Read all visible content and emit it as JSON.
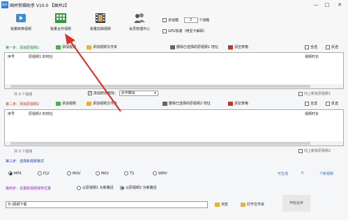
{
  "window": {
    "title": "国并剪辑助手 V10.0 【国并2】",
    "icon_label": "国并",
    "controls": [
      "—",
      "□",
      "✕"
    ]
  },
  "toolbar": {
    "buttons": [
      {
        "label": "批量转换视频",
        "icon": "convert-icon"
      },
      {
        "label": "批量合并视频",
        "icon": "merge-icon"
      },
      {
        "label": "批量剪辑视频",
        "icon": "clip-icon"
      },
      {
        "label": "会员管理中心",
        "icon": "member-icon"
      }
    ],
    "multithread_label": "多线程",
    "thread_count": "2",
    "thread_unit": "个线程",
    "gpu_label": "GPU加速（用显卡解码）"
  },
  "step1": {
    "label": "第一步：添加原视频1",
    "add_video": "添加视频",
    "add_folder": "添加视频文件夹",
    "delete_selected": "删除已选择的原视频1 地址",
    "clear_table": "清空表格",
    "select_all": "全选",
    "invert_select": "反选",
    "columns": {
      "index": "序号",
      "address": "原视频1 的地址",
      "duration": "视频时长"
    },
    "count_text": "共 0 个视频",
    "add_watermark_label": "添加转场特效：",
    "watermark_value": "水平推出",
    "up_all_label": "向上新有原视频1"
  },
  "step2": {
    "label": "第二步：添加原视频2",
    "add_video": "添加视频",
    "add_folder": "添加视频文件夹",
    "delete_selected": "删除已选择的原视频2 地址",
    "clear_table": "清空表格",
    "select_all": "全选",
    "invert_select": "反选",
    "columns": {
      "index": "序号",
      "address": "原视频2 的地址",
      "duration": "视频时长"
    },
    "count_text": "共 0 个视频",
    "up_all_label": "向上新有原视频2"
  },
  "step3": {
    "label": "第三步：选择新视频格式",
    "formats": [
      "MP4",
      "FLV",
      "MOV",
      "MKV",
      "TS",
      "WMV"
    ],
    "selected": "MP4",
    "generate_label": "可生成",
    "generate_count": "0",
    "generate_unit": "个新视频"
  },
  "step4": {
    "label": "第四步：设置新视频保存位置",
    "option_a": "以原视频1 为新路径",
    "option_b": "以原视频2 为新路径",
    "selected": "option_b",
    "path_value": "E:\\视频下载",
    "browse": "浏览",
    "open_folder": "打开文件夹",
    "start": "开始合并"
  },
  "colors": {
    "step_label": "#1a3cc8",
    "accent_red": "#d0301a",
    "annotation_arrow": "#e0302a"
  }
}
